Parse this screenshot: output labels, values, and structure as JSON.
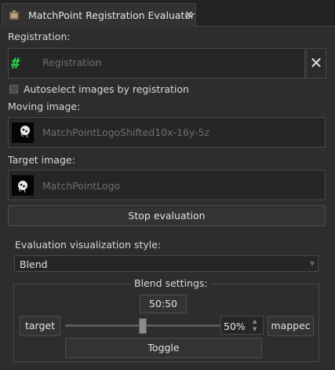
{
  "tab": {
    "title": "MatchPoint Registration Evaluator",
    "close": "×"
  },
  "registration": {
    "label": "Registration:",
    "placeholder": "Registration",
    "clear": "✕"
  },
  "autoselect": {
    "label": "Autoselect images by registration",
    "checked": false
  },
  "moving": {
    "label": "Moving image:",
    "value": "MatchPointLogoShifted10x-16y-5z"
  },
  "target": {
    "label": "Target image:",
    "value": "MatchPointLogo"
  },
  "stop_button": "Stop evaluation",
  "style": {
    "label": "Evaluation visualization style:",
    "selected": "Blend"
  },
  "blend": {
    "title": "Blend settings:",
    "ratio": "50:50",
    "target_button": "target",
    "mapped_button": "mappec",
    "slider_fraction": 0.5,
    "percent": "50%",
    "toggle": "Toggle"
  },
  "colors": {
    "accent_green": "#22d64a",
    "background": "#2d2d2d"
  }
}
